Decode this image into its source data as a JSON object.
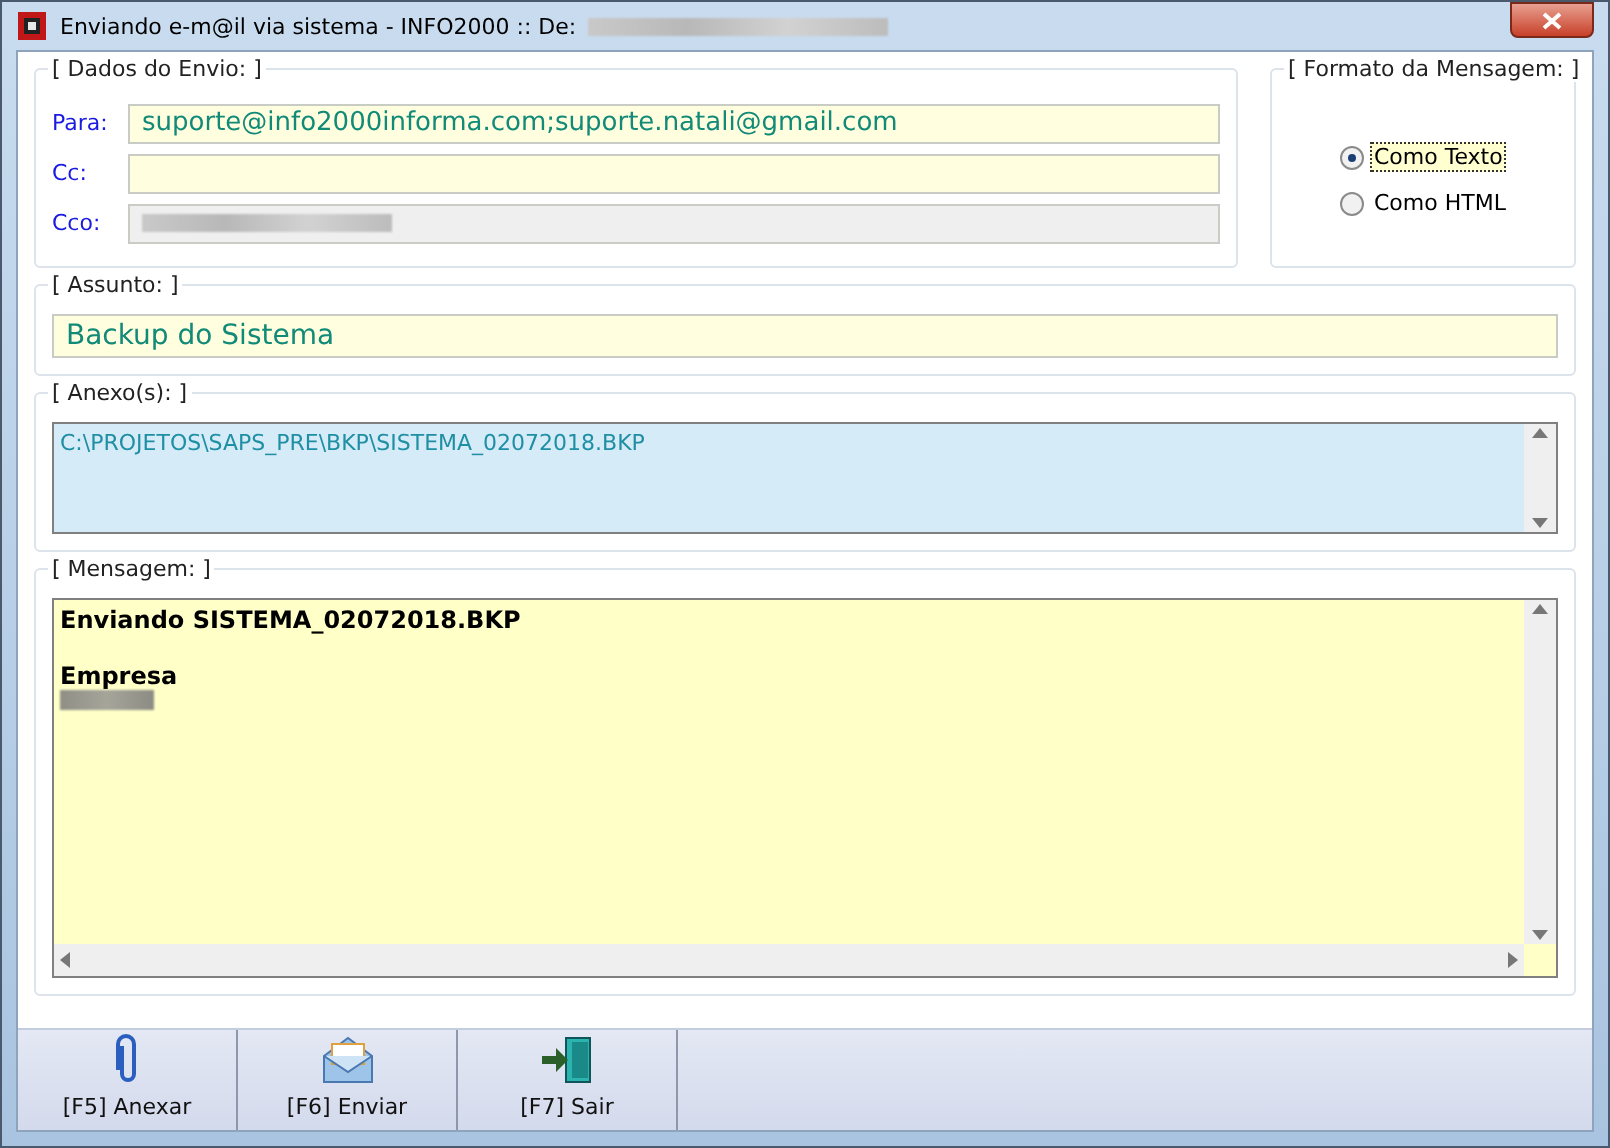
{
  "window": {
    "title": "Enviando e-m@il via sistema - INFO2000 :: De:"
  },
  "envio": {
    "legend": "[ Dados do Envio: ]",
    "fields": [
      {
        "label": "Para:",
        "kind": "text",
        "value": "suporte@info2000informa.com;suporte.natali@gmail.com"
      },
      {
        "label": "Cc:",
        "kind": "text"
      },
      {
        "label": "Cco:",
        "kind": "redacted"
      }
    ]
  },
  "formato": {
    "legend": "[ Formato da Mensagem: ]",
    "options": [
      {
        "label": "Como Texto",
        "selected": true
      },
      {
        "label": "Como HTML",
        "selected": false
      }
    ]
  },
  "assunto": {
    "legend": "[ Assunto: ]",
    "value": "Backup do Sistema"
  },
  "anexos": {
    "legend": "[ Anexo(s): ]",
    "items": [
      "C:\\PROJETOS\\SAPS_PRE\\BKP\\SISTEMA_02072018.BKP"
    ]
  },
  "mensagem": {
    "legend": "[ Mensagem: ]",
    "lines": [
      {
        "kind": "text",
        "text": "Enviando SISTEMA_02072018.BKP"
      },
      {
        "kind": "blank"
      },
      {
        "kind": "text",
        "text": "Empresa"
      },
      {
        "kind": "redacted"
      }
    ]
  },
  "toolbar": [
    {
      "label": "[F5] Anexar",
      "kind": "attach"
    },
    {
      "label": "[F6] Enviar",
      "kind": "send"
    },
    {
      "label": "[F7] Sair",
      "kind": "exit"
    }
  ]
}
